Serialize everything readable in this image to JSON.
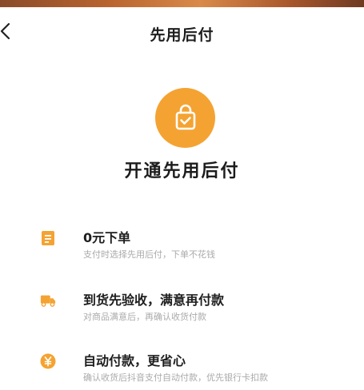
{
  "header": {
    "title": "先用后付",
    "back_icon": "chevron-left-icon"
  },
  "hero": {
    "icon": "shopping-bag-check-icon",
    "title": "开通先用后付",
    "accent_color": "#f4a332"
  },
  "features": [
    {
      "icon": "document-icon",
      "title": "0元下单",
      "desc": "支付时选择先用后付，下单不花钱"
    },
    {
      "icon": "delivery-truck-icon",
      "title": "到货先验收，满意再付款",
      "desc": "对商品满意后，再确认收货付款"
    },
    {
      "icon": "yuan-coin-icon",
      "title": "自动付款，更省心",
      "desc": "确认收货后抖音支付自动付款，优先银行卡扣款"
    }
  ]
}
